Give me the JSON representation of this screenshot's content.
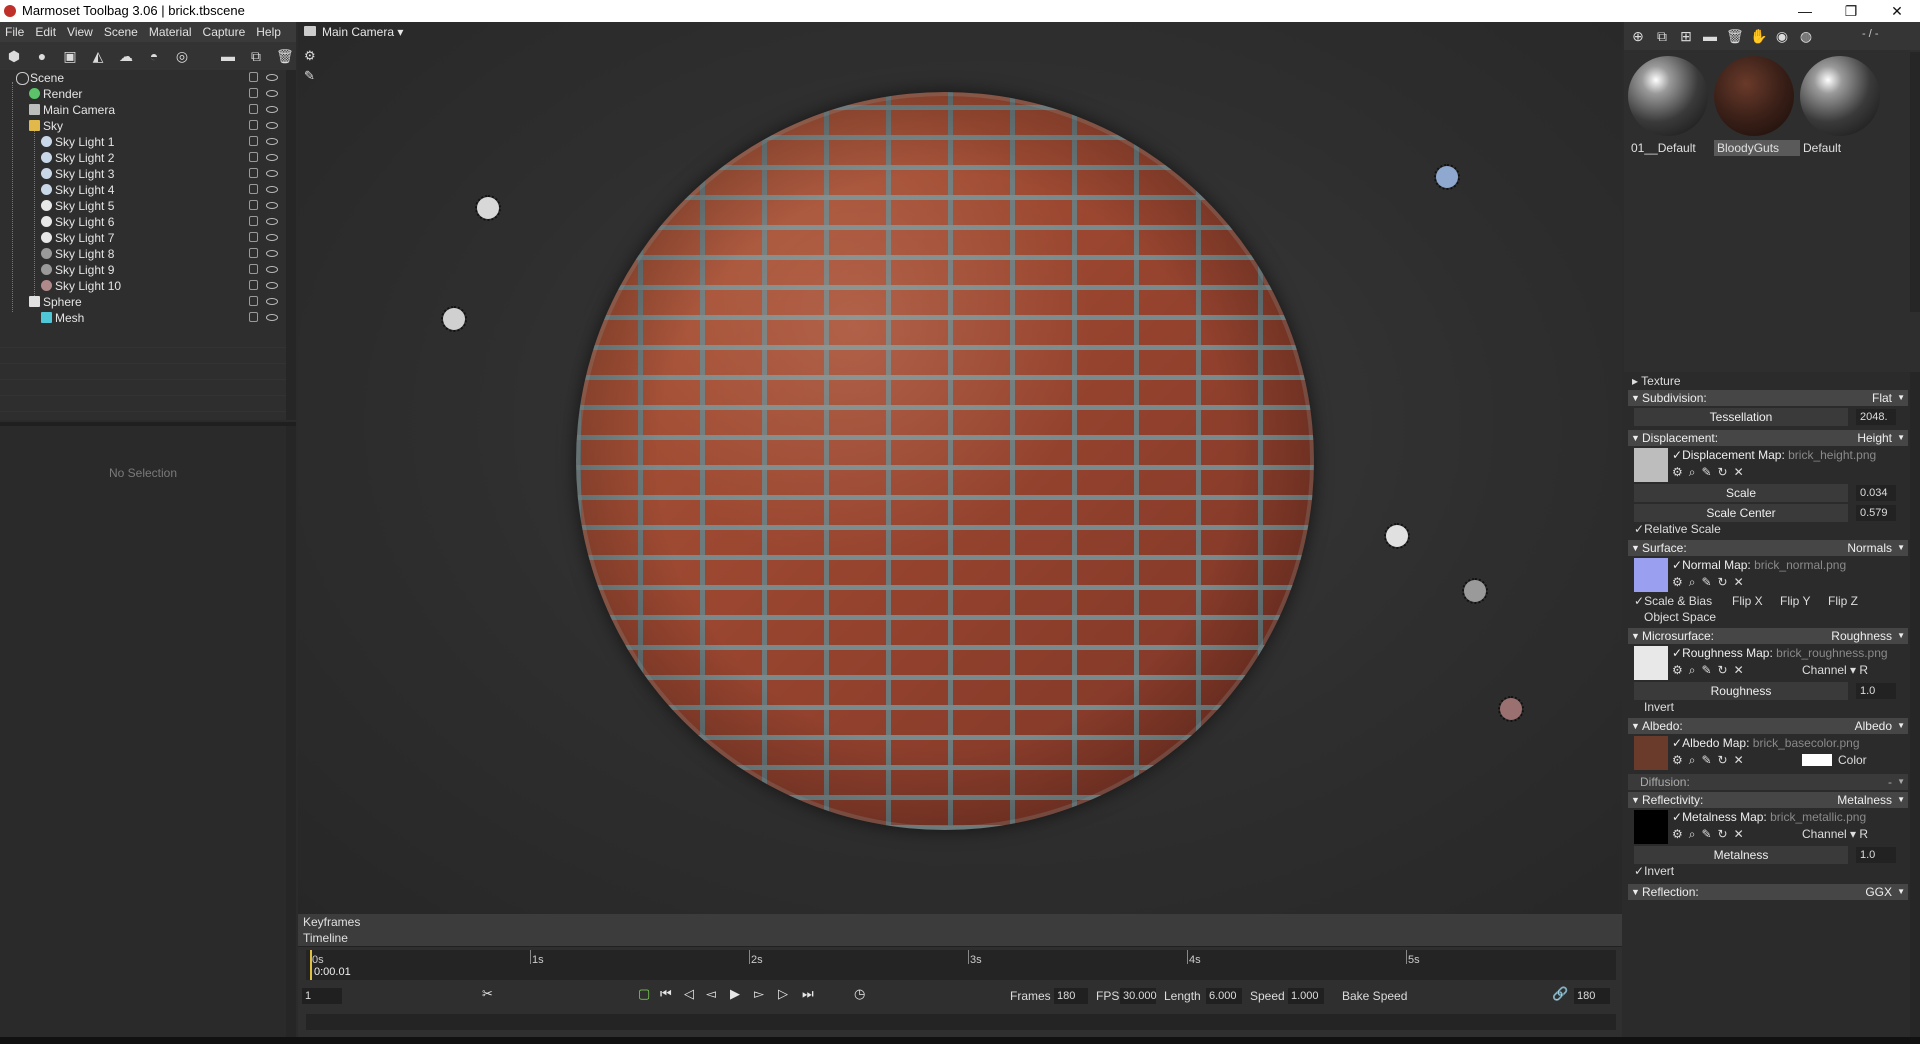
{
  "window": {
    "title": "Marmoset Toolbag 3.06  |  brick.tbscene",
    "minimize": "—",
    "restore": "❐",
    "close": "✕"
  },
  "menu": [
    "File",
    "Edit",
    "View",
    "Scene",
    "Material",
    "Capture",
    "Help"
  ],
  "scene_tree": [
    {
      "label": "Scene"
    },
    {
      "label": "Render"
    },
    {
      "label": "Main Camera"
    },
    {
      "label": "Sky"
    },
    {
      "label": "Sky Light 1"
    },
    {
      "label": "Sky Light 2"
    },
    {
      "label": "Sky Light 3"
    },
    {
      "label": "Sky Light 4"
    },
    {
      "label": "Sky Light 5"
    },
    {
      "label": "Sky Light 6"
    },
    {
      "label": "Sky Light 7"
    },
    {
      "label": "Sky Light 8"
    },
    {
      "label": "Sky Light 9"
    },
    {
      "label": "Sky Light 10"
    },
    {
      "label": "Sphere"
    },
    {
      "label": "Mesh"
    }
  ],
  "properties": {
    "empty_text": "No Selection"
  },
  "viewport": {
    "camera_label": "Main Camera ▾"
  },
  "sky_light_colors": [
    "#d8d8d8",
    "#d0d0d0",
    "#8fa8d0",
    "#e0e0e0",
    "#9a9a9a",
    "#9a7070"
  ],
  "timeline": {
    "keyframes_label": "Keyframes",
    "timeline_label": "Timeline",
    "current_time": "0:00.01",
    "ticks": [
      "0s",
      "1s",
      "2s",
      "3s",
      "4s",
      "5s"
    ],
    "frame_field": "1",
    "frames_label": "Frames",
    "frames": "180",
    "fps_label": "FPS",
    "fps": "30.000",
    "length_label": "Length",
    "length": "6.000",
    "speed_label": "Speed",
    "speed": "1.000",
    "bake_speed": "Bake Speed",
    "end_frame": "180"
  },
  "materials": {
    "page_indicator": "- / -",
    "items": [
      {
        "name": "01__Default"
      },
      {
        "name": "BloodyGuts"
      },
      {
        "name": "Default"
      }
    ]
  },
  "material_editor": {
    "texture": "Texture",
    "subdivision": {
      "name": "Subdivision:",
      "mode": "Flat",
      "tess_label": "Tessellation",
      "tess_value": "2048."
    },
    "displacement": {
      "name": "Displacement:",
      "mode": "Height",
      "map_label": "Displacement Map:",
      "map_file": "brick_height.png",
      "scale_label": "Scale",
      "scale_value": "0.034",
      "center_label": "Scale Center",
      "center_value": "0.579",
      "relative": "Relative Scale"
    },
    "surface": {
      "name": "Surface:",
      "mode": "Normals",
      "map_label": "Normal Map:",
      "map_file": "brick_normal.png",
      "scale_bias": "Scale & Bias",
      "flip_x": "Flip X",
      "flip_y": "Flip Y",
      "flip_z": "Flip Z",
      "object_space": "Object Space"
    },
    "microsurface": {
      "name": "Microsurface:",
      "mode": "Roughness",
      "map_label": "Roughness Map:",
      "map_file": "brick_roughness.png",
      "channel": "Channel ▾ R",
      "value_label": "Roughness",
      "value": "1.0",
      "invert": "Invert"
    },
    "albedo": {
      "name": "Albedo:",
      "mode": "Albedo",
      "map_label": "Albedo Map:",
      "map_file": "brick_basecolor.png",
      "color_label": "Color"
    },
    "diffusion": {
      "name": "Diffusion:",
      "mode": "-"
    },
    "reflectivity": {
      "name": "Reflectivity:",
      "mode": "Metalness",
      "map_label": "Metalness Map:",
      "map_file": "brick_metallic.png",
      "channel": "Channel ▾ R",
      "value_label": "Metalness",
      "value": "1.0",
      "invert": "Invert"
    },
    "reflection": {
      "name": "Reflection:",
      "mode": "GGX"
    }
  }
}
